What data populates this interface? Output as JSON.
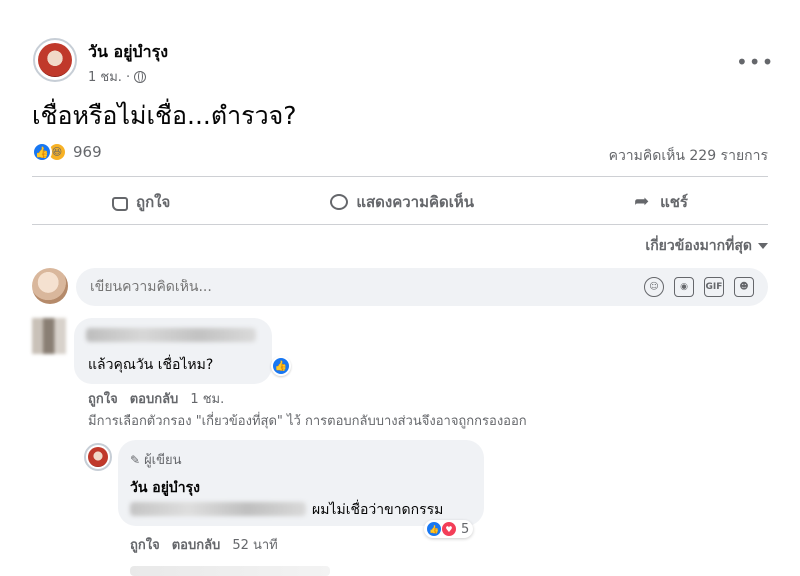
{
  "post": {
    "author": "วัน อยู่บำรุง",
    "time": "1 ชม. ·",
    "text": "เชื่อหรือไม่เชื่อ...ตำรวจ?",
    "more_label": "•••",
    "reaction_count": "969",
    "comment_count": "ความคิดเห็น 229 รายการ"
  },
  "actions": {
    "like": "ถูกใจ",
    "comment": "แสดงความคิดเห็น",
    "share": "แชร์"
  },
  "sort": {
    "label": "เกี่ยวข้องมากที่สุด"
  },
  "composer": {
    "placeholder": "เขียนความคิดเห็น...",
    "icons": [
      "emoji-icon",
      "camera-icon",
      "gif-icon",
      "sticker-icon"
    ],
    "gif_label": "GIF"
  },
  "comments": [
    {
      "text": "แล้วคุณวัน เชื่อไหม?",
      "like_label": "ถูกใจ",
      "reply_label": "ตอบกลับ",
      "time": "1 ชม."
    }
  ],
  "filter_note": "มีการเลือกตัวกรอง \"เกี่ยวข้องที่สุด\" ไว้ การตอบกลับบางส่วนจึงอาจถูกกรองออก",
  "reply": {
    "badge": "ผู้เขียน",
    "author": "วัน อยู่บำรุง",
    "text": "ผมไม่เชื่อว่าขาดกรรม",
    "reaction_count": "5",
    "like_label": "ถูกใจ",
    "reply_label": "ตอบกลับ",
    "time": "52 นาที"
  },
  "colors": {
    "accent": "#1877f2",
    "secondary_text": "#65676b",
    "bubble": "#f0f2f5",
    "love": "#f33e58",
    "haha": "#f7b125"
  }
}
